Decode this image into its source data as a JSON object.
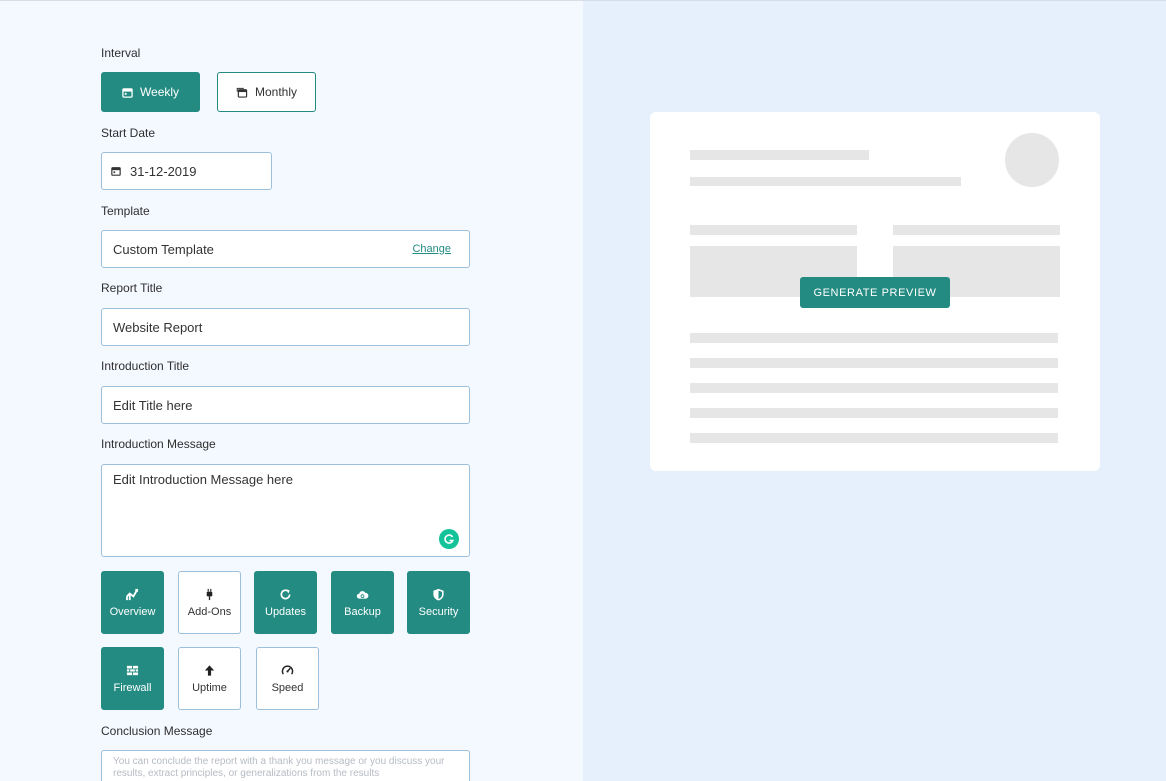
{
  "form": {
    "interval": {
      "label": "Interval",
      "options": [
        {
          "label": "Weekly",
          "active": true
        },
        {
          "label": "Monthly",
          "active": false
        }
      ]
    },
    "start_date": {
      "label": "Start Date",
      "value": "31-12-2019"
    },
    "template": {
      "label": "Template",
      "value": "Custom Template",
      "change_label": "Change"
    },
    "report_title": {
      "label": "Report Title",
      "value": "Website Report"
    },
    "intro_title": {
      "label": "Introduction Title",
      "value": "Edit Title here"
    },
    "intro_message": {
      "label": "Introduction Message",
      "value": "Edit Introduction Message here"
    },
    "sections": [
      {
        "label": "Overview",
        "icon": "overview-icon",
        "active": true
      },
      {
        "label": "Add-Ons",
        "icon": "plug-icon",
        "active": false
      },
      {
        "label": "Updates",
        "icon": "refresh-icon",
        "active": true
      },
      {
        "label": "Backup",
        "icon": "cloud-backup-icon",
        "active": true
      },
      {
        "label": "Security",
        "icon": "shield-icon",
        "active": true
      },
      {
        "label": "Firewall",
        "icon": "brick-wall-icon",
        "active": true
      },
      {
        "label": "Uptime",
        "icon": "arrow-up-icon",
        "active": false
      },
      {
        "label": "Speed",
        "icon": "speedometer-icon",
        "active": false
      }
    ],
    "conclusion": {
      "label": "Conclusion Message",
      "placeholder": "You can conclude the report with a thank you message or you discuss your results, extract principles, or generalizations from the results"
    }
  },
  "preview": {
    "generate_label": "GENERATE PREVIEW"
  },
  "colors": {
    "accent": "#238b81",
    "grammarly": "#15c39a",
    "left_bg": "#f4f8ff",
    "right_bg": "#e6f0fc"
  }
}
